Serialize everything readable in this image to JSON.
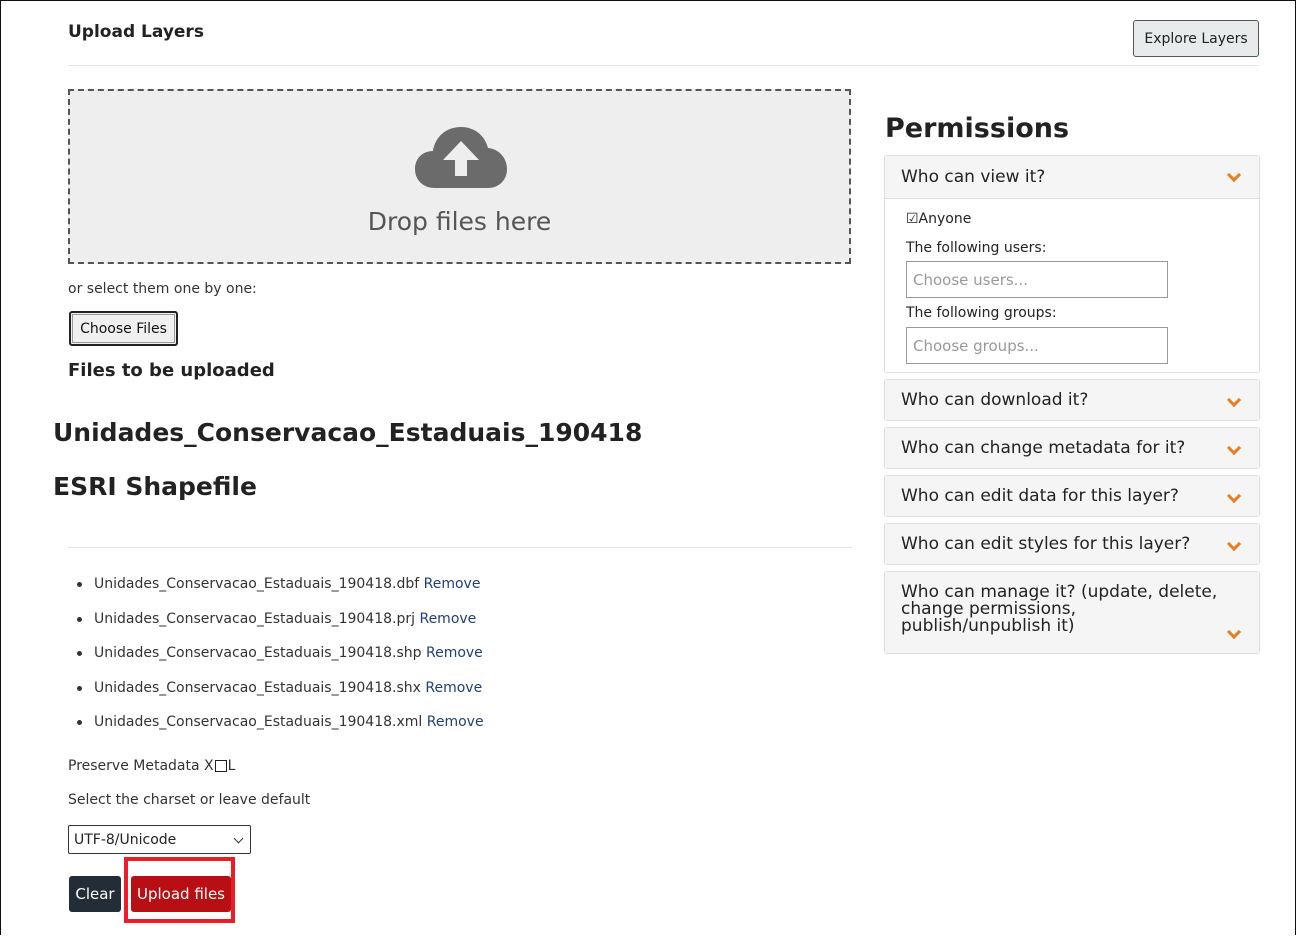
{
  "header": {
    "title": "Upload Layers",
    "explore_label": "Explore Layers"
  },
  "dropzone": {
    "text": "Drop files here",
    "icon": "cloud-upload-icon"
  },
  "upload": {
    "select_hint": "or select them one by one:",
    "choose_label": "Choose Files",
    "files_heading": "Files to be uploaded",
    "layer_name": "Unidades_Conservacao_Estaduais_190418",
    "layer_type": "ESRI Shapefile",
    "remove_label": "Remove",
    "files": [
      "Unidades_Conservacao_Estaduais_190418.dbf",
      "Unidades_Conservacao_Estaduais_190418.prj",
      "Unidades_Conservacao_Estaduais_190418.shp",
      "Unidades_Conservacao_Estaduais_190418.shx",
      "Unidades_Conservacao_Estaduais_190418.xml"
    ],
    "preserve_prefix": "Preserve Metadata X",
    "preserve_suffix": "L",
    "charset_label": "Select the charset or leave default",
    "charset_value": "UTF-8/Unicode",
    "clear_label": "Clear",
    "upload_label": "Upload files"
  },
  "permissions": {
    "title": "Permissions",
    "view": {
      "label": "Who can view it?",
      "anyone_label": "☑Anyone",
      "users_label": "The following users:",
      "users_placeholder": "Choose users...",
      "groups_label": "The following groups:",
      "groups_placeholder": "Choose groups..."
    },
    "download": "Who can download it?",
    "metadata": "Who can change metadata for it?",
    "edit_data": "Who can edit data for this layer?",
    "edit_styles": "Who can edit styles for this layer?",
    "manage": "Who can manage it? (update, delete, change permissions, publish/unpublish it)"
  },
  "colors": {
    "accent_orange": "#e67e22",
    "upload_red": "#b70f13",
    "highlight_red": "#ee1c24",
    "clear_dark": "#222d38"
  }
}
